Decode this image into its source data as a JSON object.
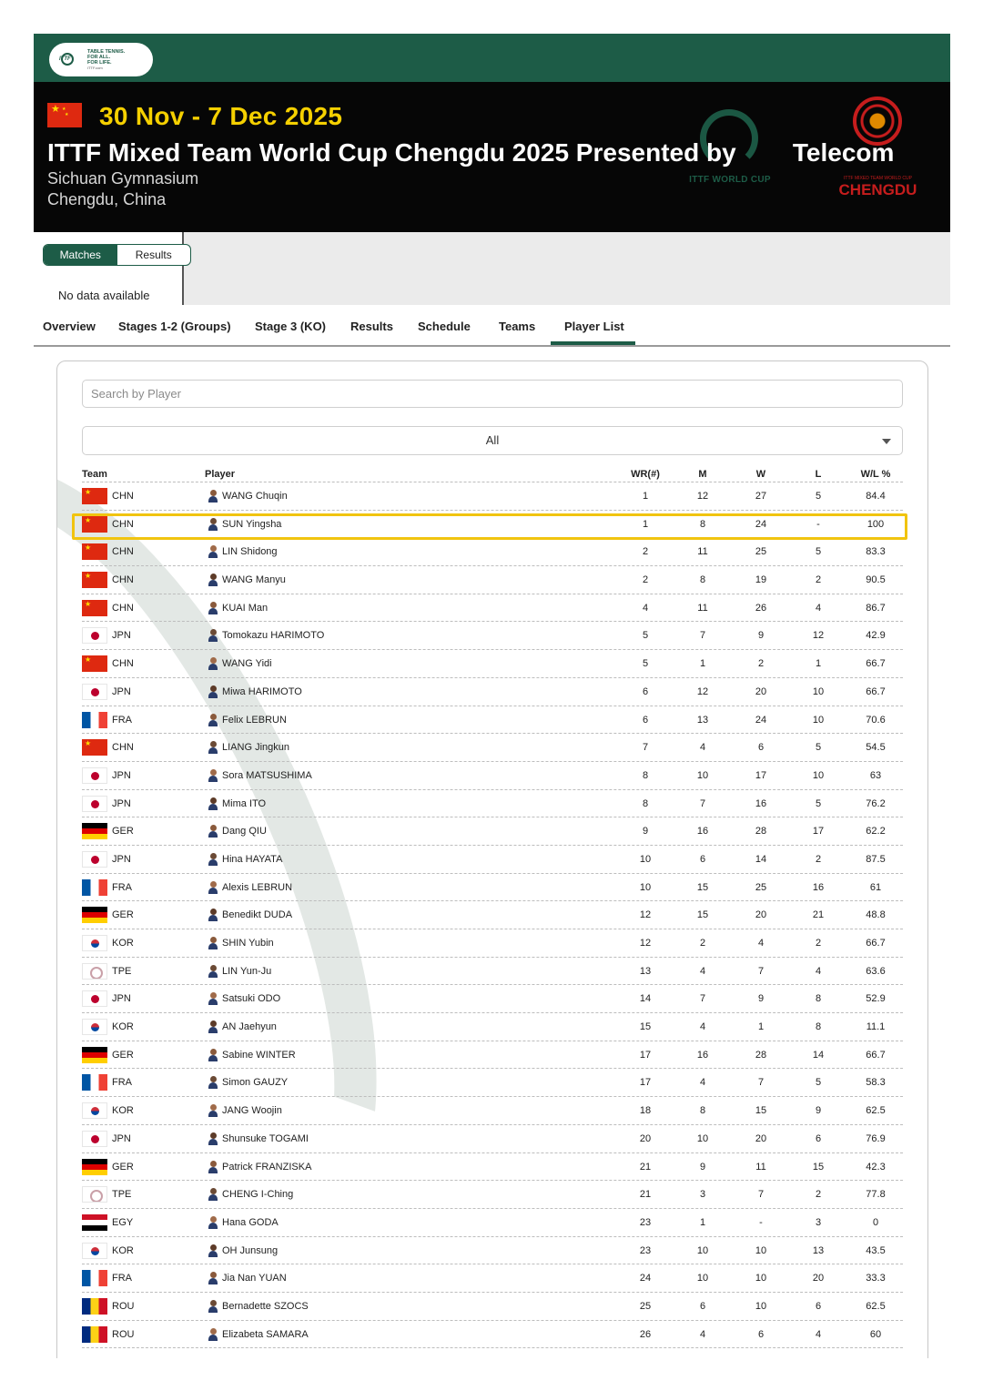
{
  "header": {
    "logo_lines": [
      "TABLE TENNIS.",
      "FOR ALL.",
      "FOR LIFE."
    ],
    "logo_mark": "ITTF",
    "logo_small": "ITTF.com"
  },
  "hero": {
    "date": "30 Nov - 7 Dec 2025",
    "title": "ITTF Mixed Team World Cup Chengdu 2025 Presented by",
    "title_tail": "Telecom",
    "venue": "Sichuan Gymnasium",
    "city": "Chengdu, China",
    "world_cup_logo_text": "ITTF WORLD CUP",
    "chengdu_logo_sub": "ITTF MIXED TEAM WORLD CUP",
    "chengdu_logo_name": "CHENGDU"
  },
  "widget": {
    "tabs": [
      "Matches",
      "Results"
    ],
    "active_tab": "Matches",
    "empty_text": "No data available"
  },
  "nav": {
    "items": [
      "Overview",
      "Stages 1-2 (Groups)",
      "Stage 3 (KO)",
      "Results",
      "Schedule",
      "Teams",
      "Player List"
    ],
    "active": "Player List"
  },
  "player_list": {
    "search_placeholder": "Search by Player",
    "filter_value": "All",
    "columns": {
      "team": "Team",
      "player": "Player",
      "wr": "WR(#)",
      "m": "M",
      "w": "W",
      "l": "L",
      "wl": "W/L %"
    },
    "highlighted_player": "SUN Yingsha",
    "rows": [
      {
        "team": "CHN",
        "player": "WANG Chuqin",
        "wr": "1",
        "m": "12",
        "w": "27",
        "l": "5",
        "wl": "84.4"
      },
      {
        "team": "CHN",
        "player": "SUN Yingsha",
        "wr": "1",
        "m": "8",
        "w": "24",
        "l": "-",
        "wl": "100"
      },
      {
        "team": "CHN",
        "player": "LIN Shidong",
        "wr": "2",
        "m": "11",
        "w": "25",
        "l": "5",
        "wl": "83.3"
      },
      {
        "team": "CHN",
        "player": "WANG Manyu",
        "wr": "2",
        "m": "8",
        "w": "19",
        "l": "2",
        "wl": "90.5"
      },
      {
        "team": "CHN",
        "player": "KUAI Man",
        "wr": "4",
        "m": "11",
        "w": "26",
        "l": "4",
        "wl": "86.7"
      },
      {
        "team": "JPN",
        "player": "Tomokazu HARIMOTO",
        "wr": "5",
        "m": "7",
        "w": "9",
        "l": "12",
        "wl": "42.9"
      },
      {
        "team": "CHN",
        "player": "WANG Yidi",
        "wr": "5",
        "m": "1",
        "w": "2",
        "l": "1",
        "wl": "66.7"
      },
      {
        "team": "JPN",
        "player": "Miwa HARIMOTO",
        "wr": "6",
        "m": "12",
        "w": "20",
        "l": "10",
        "wl": "66.7"
      },
      {
        "team": "FRA",
        "player": "Felix LEBRUN",
        "wr": "6",
        "m": "13",
        "w": "24",
        "l": "10",
        "wl": "70.6"
      },
      {
        "team": "CHN",
        "player": "LIANG Jingkun",
        "wr": "7",
        "m": "4",
        "w": "6",
        "l": "5",
        "wl": "54.5"
      },
      {
        "team": "JPN",
        "player": "Sora MATSUSHIMA",
        "wr": "8",
        "m": "10",
        "w": "17",
        "l": "10",
        "wl": "63"
      },
      {
        "team": "JPN",
        "player": "Mima ITO",
        "wr": "8",
        "m": "7",
        "w": "16",
        "l": "5",
        "wl": "76.2"
      },
      {
        "team": "GER",
        "player": "Dang QIU",
        "wr": "9",
        "m": "16",
        "w": "28",
        "l": "17",
        "wl": "62.2"
      },
      {
        "team": "JPN",
        "player": "Hina HAYATA",
        "wr": "10",
        "m": "6",
        "w": "14",
        "l": "2",
        "wl": "87.5"
      },
      {
        "team": "FRA",
        "player": "Alexis LEBRUN",
        "wr": "10",
        "m": "15",
        "w": "25",
        "l": "16",
        "wl": "61"
      },
      {
        "team": "GER",
        "player": "Benedikt DUDA",
        "wr": "12",
        "m": "15",
        "w": "20",
        "l": "21",
        "wl": "48.8"
      },
      {
        "team": "KOR",
        "player": "SHIN Yubin",
        "wr": "12",
        "m": "2",
        "w": "4",
        "l": "2",
        "wl": "66.7"
      },
      {
        "team": "TPE",
        "player": "LIN Yun-Ju",
        "wr": "13",
        "m": "4",
        "w": "7",
        "l": "4",
        "wl": "63.6"
      },
      {
        "team": "JPN",
        "player": "Satsuki ODO",
        "wr": "14",
        "m": "7",
        "w": "9",
        "l": "8",
        "wl": "52.9"
      },
      {
        "team": "KOR",
        "player": "AN Jaehyun",
        "wr": "15",
        "m": "4",
        "w": "1",
        "l": "8",
        "wl": "11.1"
      },
      {
        "team": "GER",
        "player": "Sabine WINTER",
        "wr": "17",
        "m": "16",
        "w": "28",
        "l": "14",
        "wl": "66.7"
      },
      {
        "team": "FRA",
        "player": "Simon GAUZY",
        "wr": "17",
        "m": "4",
        "w": "7",
        "l": "5",
        "wl": "58.3"
      },
      {
        "team": "KOR",
        "player": "JANG Woojin",
        "wr": "18",
        "m": "8",
        "w": "15",
        "l": "9",
        "wl": "62.5"
      },
      {
        "team": "JPN",
        "player": "Shunsuke TOGAMI",
        "wr": "20",
        "m": "10",
        "w": "20",
        "l": "6",
        "wl": "76.9"
      },
      {
        "team": "GER",
        "player": "Patrick FRANZISKA",
        "wr": "21",
        "m": "9",
        "w": "11",
        "l": "15",
        "wl": "42.3"
      },
      {
        "team": "TPE",
        "player": "CHENG I-Ching",
        "wr": "21",
        "m": "3",
        "w": "7",
        "l": "2",
        "wl": "77.8"
      },
      {
        "team": "EGY",
        "player": "Hana GODA",
        "wr": "23",
        "m": "1",
        "w": "-",
        "l": "3",
        "wl": "0"
      },
      {
        "team": "KOR",
        "player": "OH Junsung",
        "wr": "23",
        "m": "10",
        "w": "10",
        "l": "13",
        "wl": "43.5"
      },
      {
        "team": "FRA",
        "player": "Jia Nan YUAN",
        "wr": "24",
        "m": "10",
        "w": "10",
        "l": "20",
        "wl": "33.3"
      },
      {
        "team": "ROU",
        "player": "Bernadette SZOCS",
        "wr": "25",
        "m": "6",
        "w": "10",
        "l": "6",
        "wl": "62.5"
      },
      {
        "team": "ROU",
        "player": "Elizabeta SAMARA",
        "wr": "26",
        "m": "4",
        "w": "6",
        "l": "4",
        "wl": "60"
      }
    ]
  }
}
